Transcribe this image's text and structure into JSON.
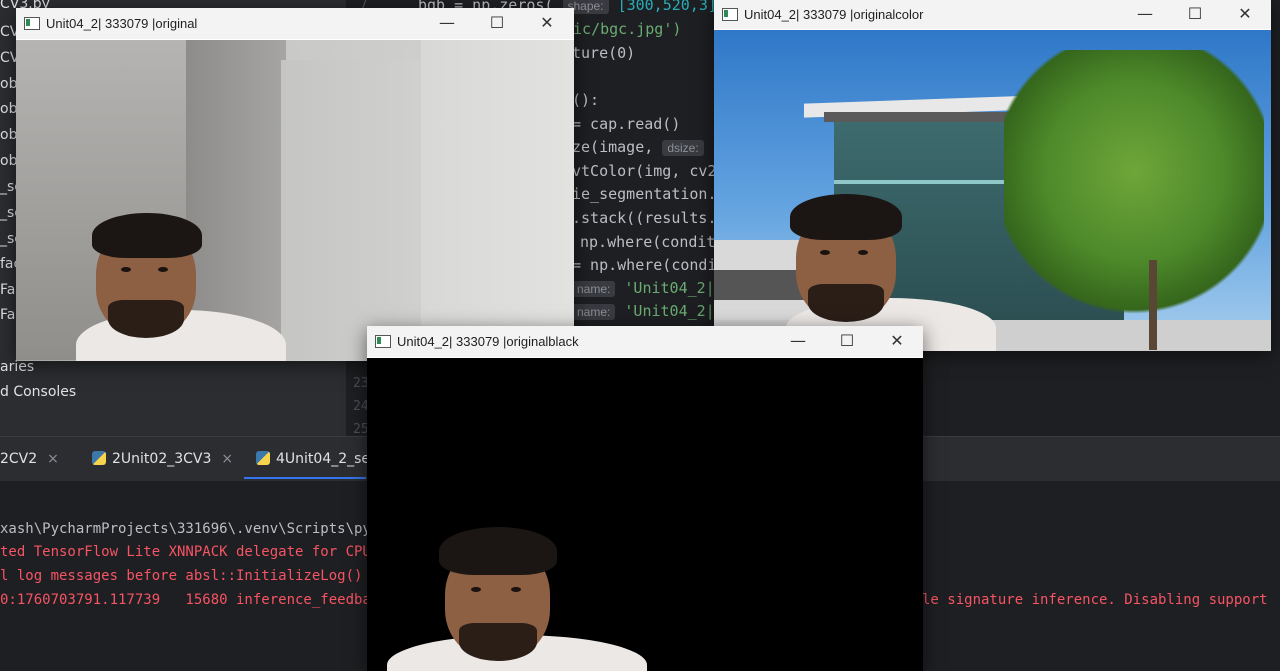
{
  "ide": {
    "project_items": [
      {
        "label": "CV3.py"
      },
      {
        "label": "CV"
      },
      {
        "label": "CV"
      },
      {
        "label": "ob"
      },
      {
        "label": "ob"
      },
      {
        "label": "ob"
      },
      {
        "label": "ob"
      },
      {
        "label": "_se"
      },
      {
        "label": "_se"
      },
      {
        "label": "_se"
      },
      {
        "label": "fac"
      },
      {
        "label": "Fa"
      },
      {
        "label": "Fa"
      },
      {
        "label": "aries"
      },
      {
        "label": "d Consoles"
      }
    ],
    "line_numbers": [
      "7",
      "23",
      "24",
      "25"
    ],
    "code": {
      "l1_a": "bgb = np.zeros(",
      "l1_hint": "shape:",
      "l1_b": "[300,520,3],",
      "l2": "pic/bgc.jpg')",
      "l3": "ture(0)",
      "l4": "():",
      "l5": "= cap.read()",
      "l6_a": "ze(image,",
      "l6_hint": "dsize:",
      "l6_b": "(",
      "l7": "vtColor(img, cv2.",
      "l8": "ie_segmentation.p",
      "l9": ".stack((results.s",
      "l10": "np.where(conditi",
      "l11": "= np.where(condit",
      "l12_hint": "name:",
      "l12_str": "'Unit04_2|",
      "l13_hint": "name:",
      "l13_str": "'Unit04_2|"
    },
    "tabs": [
      {
        "label": "2CV2",
        "close": "×"
      },
      {
        "label": "2Unit02_3CV3",
        "close": "×"
      },
      {
        "label": "4Unit04_2_se",
        "close": ""
      }
    ],
    "console": [
      {
        "text": "xash\\PycharmProjects\\331696\\.venv\\Scripts\\py",
        "kind": "plain"
      },
      {
        "text": "ted TensorFlow Lite XNNPACK delegate for CPU",
        "kind": "red"
      },
      {
        "text": "l log messages before absl::InitializeLog()",
        "kind": "red"
      },
      {
        "text": "0:1760703791.117739   15680 inference_feedba",
        "kind": "red"
      },
      {
        "text": "le signature inference. Disabling support",
        "kind": "red"
      }
    ]
  },
  "windows": {
    "original": {
      "title": "Unit04_2| 333079 |original"
    },
    "color": {
      "title": "Unit04_2| 333079 |originalcolor"
    },
    "black": {
      "title": "Unit04_2| 333079 |originalblack"
    }
  },
  "window_buttons": {
    "minimize": "—",
    "maximize": "☐",
    "close": "✕"
  },
  "colors": {
    "accent": "#3574f0",
    "error_text": "#f75464",
    "string": "#6aab73"
  }
}
